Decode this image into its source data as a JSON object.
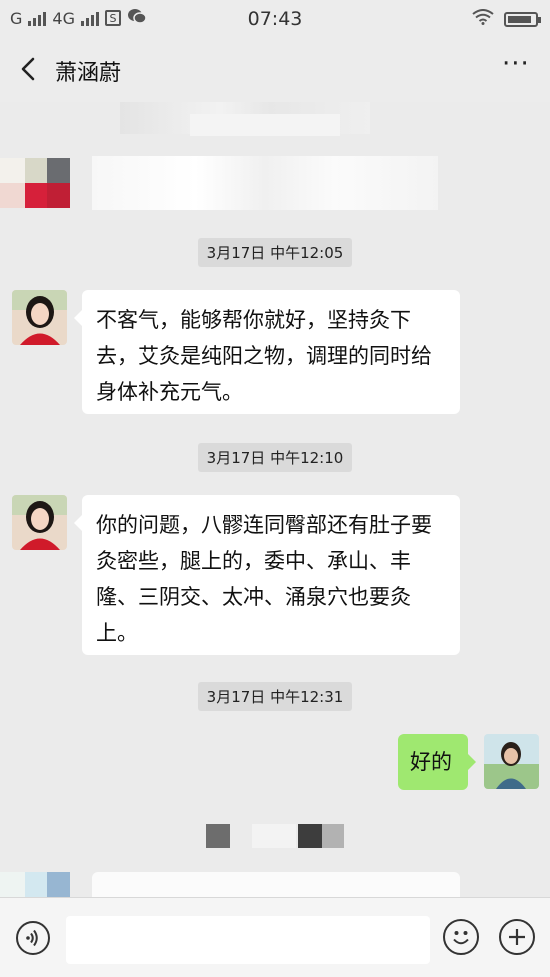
{
  "status_bar": {
    "carrier_g": "G",
    "network": "4G",
    "sim_icon_text": "S",
    "time": "07:43",
    "icons": [
      "signal-icon",
      "sim-icon",
      "wechat-icon",
      "wifi-icon",
      "battery-icon"
    ],
    "battery_level": 0.9
  },
  "header": {
    "title": "萧涵蔚",
    "more_label": "···"
  },
  "messages": [
    {
      "type": "timestamp",
      "text": "3月17日 中午12:05"
    },
    {
      "type": "incoming",
      "text": "不客气，能够帮你就好，坚持灸下去，艾灸是纯阳之物，调理的同时给身体补充元气。"
    },
    {
      "type": "timestamp",
      "text": "3月17日 中午12:10"
    },
    {
      "type": "incoming",
      "text": "你的问题，八髎连同臀部还有肚子要灸密些，腿上的，委中、承山、丰隆、三阴交、太冲、涌泉穴也要灸上。"
    },
    {
      "type": "timestamp",
      "text": "3月17日 中午12:31"
    },
    {
      "type": "outgoing",
      "text": "好的"
    }
  ],
  "input_bar": {
    "text_value": "",
    "icons": [
      "voice-icon",
      "emoji-icon",
      "plus-icon"
    ]
  },
  "colors": {
    "background": "#ebebeb",
    "outgoing_bubble": "#9fe870",
    "incoming_bubble": "#ffffff",
    "timestamp_bg": "#dadada"
  }
}
